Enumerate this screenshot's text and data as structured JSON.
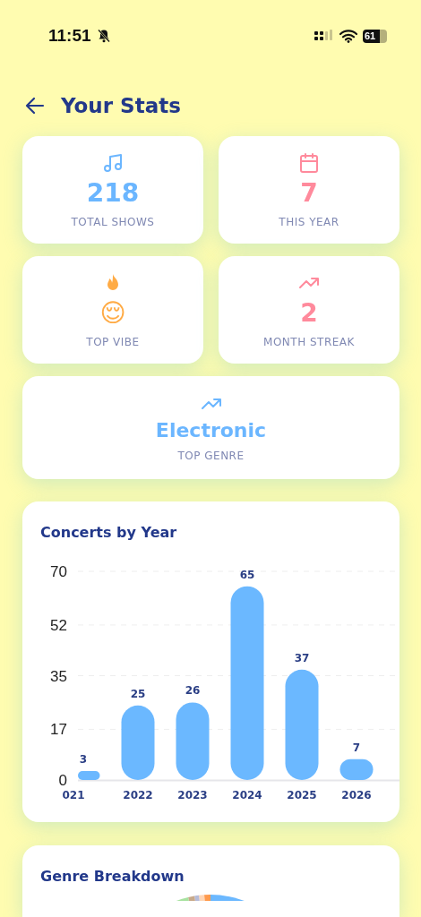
{
  "status_bar": {
    "time": "11:51",
    "battery": "61"
  },
  "header": {
    "title": "Your Stats"
  },
  "stats": [
    {
      "kind": "music",
      "value": "218",
      "label": "TOTAL SHOWS",
      "color": "#6bb6ff"
    },
    {
      "kind": "calendar",
      "value": "7",
      "label": "THIS YEAR",
      "color": "#ff8a9c"
    },
    {
      "kind": "flame",
      "value": "😌",
      "label": "TOP VIBE",
      "color": "#ffab45"
    },
    {
      "kind": "trend",
      "value": "2",
      "label": "MONTH STREAK",
      "color": "#ff8a9c"
    }
  ],
  "top_genre": {
    "kind": "trend",
    "value": "Electronic",
    "label": "TOP GENRE",
    "color": "#6bb6ff"
  },
  "concerts_by_year": {
    "title": "Concerts by Year",
    "chart_data": {
      "type": "bar",
      "categories": [
        "021",
        "2022",
        "2023",
        "2024",
        "2025",
        "2026"
      ],
      "grid": true,
      "series": [
        {
          "color": "#6bb8ff",
          "values": [
            3,
            25,
            26,
            65,
            37,
            7
          ]
        }
      ],
      "ylim": [
        0,
        70
      ],
      "yticks": [
        0,
        17,
        35,
        52,
        70
      ],
      "data_labels": true
    }
  },
  "genre_breakdown": {
    "title": "Genre Breakdown"
  }
}
